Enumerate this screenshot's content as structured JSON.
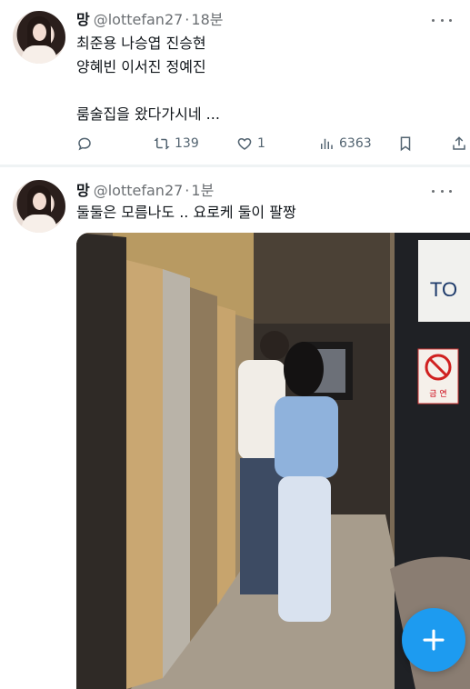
{
  "tweets": [
    {
      "author_name": "망",
      "handle": "@lottefan27",
      "separator": "·",
      "time": "18분",
      "lines": [
        "최준용 나승엽 진승현",
        "양혜빈 이서진 정예진",
        "룸술집을 왔다가시네 ..."
      ],
      "reply_count": "",
      "retweet_count": "139",
      "like_count": "1",
      "view_count": "6363"
    },
    {
      "author_name": "망",
      "handle": "@lottefan27",
      "separator": "·",
      "time": "1분",
      "lines": [
        "둘둘은 모름나도 .. 요로케 둘이 팔짱"
      ],
      "photo_sign_text": "TO",
      "no_smoking_text": "금 연"
    }
  ],
  "icons": {
    "reply": "reply-icon",
    "retweet": "retweet-icon",
    "like": "heart-icon",
    "views": "views-icon",
    "bookmark": "bookmark-icon",
    "share": "share-icon",
    "more": "more-icon",
    "compose": "compose-plus-icon"
  },
  "colors": {
    "accent": "#1d9bf0",
    "secondary_text": "#536471"
  }
}
